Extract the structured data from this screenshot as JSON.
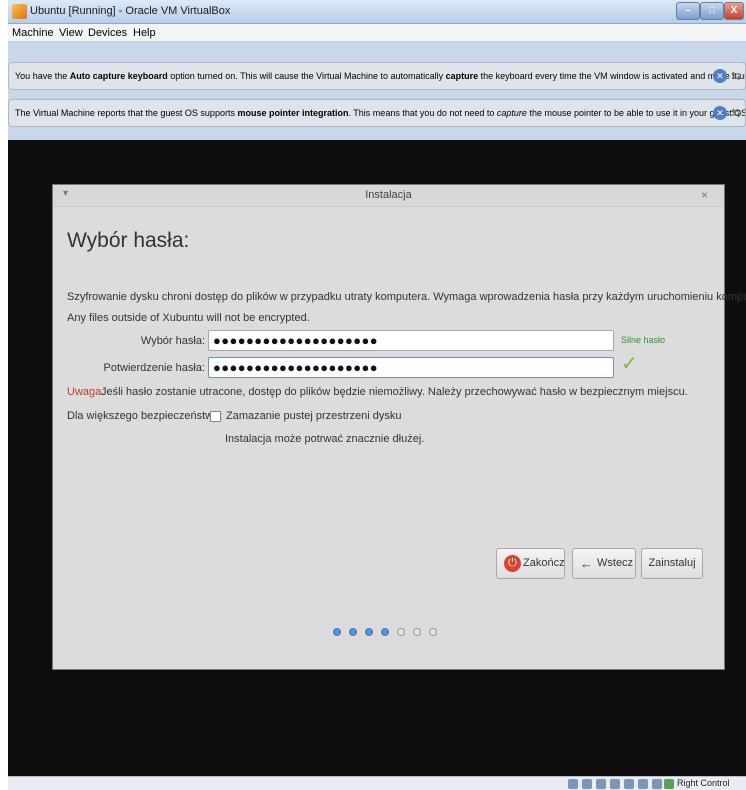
{
  "window": {
    "title": "Ubuntu [Running] - Oracle VM VirtualBox",
    "minimize_icon": "minimize-icon",
    "maximize_icon": "maximize-icon",
    "close_icon": "close-icon",
    "close_glyph": "X"
  },
  "menubar": {
    "items": [
      "Machine",
      "View",
      "Devices",
      "Help"
    ]
  },
  "notices": [
    {
      "pre": "You have the ",
      "bold1": "Auto capture keyboard",
      "mid": " option turned on. This will cause the Virtual Machine to automatically ",
      "bold2": "capture",
      "post": " the keyboard every time the VM window is activated and make it unavailable to"
    },
    {
      "pre": "The Virtual Machine reports that the guest OS supports ",
      "bold1": "mouse pointer integration",
      "mid": ". This means that you do not need to ",
      "italic": "capture",
      "post": " the mouse pointer to be able to use it in your guest OS -- all mouse"
    }
  ],
  "installer": {
    "window_title": "Instalacja",
    "menu_glyph": "▾",
    "close_glyph": "×",
    "heading": "Wybór hasła:",
    "description_line1": "Szyfrowanie dysku chroni dostęp do plików w przypadku utraty komputera. Wymaga wprowadzenia hasła przy każdym uruchomieniu komputera.",
    "description_line2": "Any files outside of Xubuntu will not be encrypted.",
    "password_label": "Wybór hasła:",
    "password_value": "●●●●●●●●●●●●●●●●●●●●",
    "strength_text": "Silne hasło",
    "confirm_label": "Potwierdzenie hasła:",
    "confirm_value": "●●●●●●●●●●●●●●●●●●●●",
    "match_icon": "checkmark-icon",
    "match_glyph": "✓",
    "warning_label": "Uwaga:",
    "warning_text": " Jeśli hasło zostanie utracone, dostęp do plików będzie niemożliwy. Należy przechowywać hasło w bezpiecznym miejscu.",
    "security_label": "Dla większego bezpieczeństwa:",
    "wipe_checkbox_label": "Zamazanie pustej przestrzeni dysku",
    "wipe_checked": false,
    "wipe_note": "Instalacja może potrwać znacznie dłużej.",
    "buttons": {
      "quit": "Zakończ",
      "quit_icon": "power-icon",
      "quit_glyph": "⏻",
      "back": "Wstecz",
      "back_icon": "arrow-left-icon",
      "back_glyph": "🡄",
      "install": "Zainstaluj"
    },
    "progress": {
      "current_step": 4,
      "total_steps": 7
    }
  },
  "statusbar": {
    "icons": [
      "hard-disk-icon",
      "optical-drive-icon",
      "usb-icon",
      "shared-folders-icon",
      "network-icon",
      "display-icon",
      "capture-icon",
      "mouse-integration-icon"
    ],
    "host_key": "Right Control"
  },
  "colors": {
    "vm_background": "#0e0e0e",
    "dialog_background": "#dcdcdc",
    "strength_green": "#2f8f2f",
    "warning_red": "#c0392b",
    "active_step": "#5b8fd6"
  }
}
